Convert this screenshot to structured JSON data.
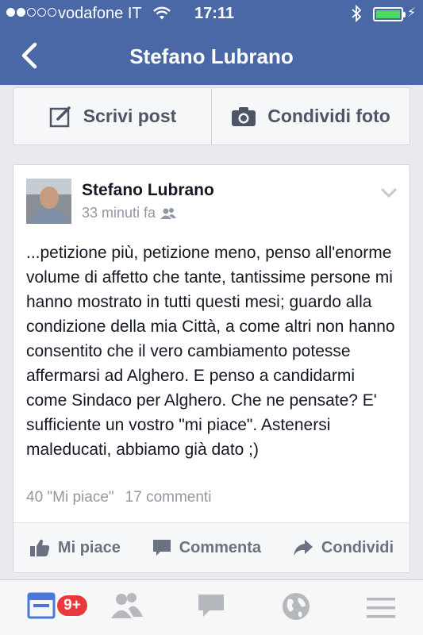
{
  "status_bar": {
    "carrier": "vodafone IT",
    "time": "17:11",
    "signal_bars_filled": 2,
    "signal_bars_total": 5
  },
  "nav": {
    "title": "Stefano Lubrano",
    "back_icon": "chevron-left-icon"
  },
  "actions": {
    "write_post_label": "Scrivi post",
    "share_photo_label": "Condividi foto"
  },
  "post": {
    "author": "Stefano Lubrano",
    "time": "33 minuti fa",
    "audience_icon": "friends-icon",
    "text": "...petizione più, petizione meno, penso all'enorme volume di affetto che tante, tantissime persone mi hanno mostrato in tutti questi mesi; guardo alla condizione della mia Città, a come altri non hanno consentito che il vero cambiamento potesse affermarsi ad Alghero. E penso a candidarmi come Sindaco per Alghero. Che ne pensate? E' sufficiente un vostro \"mi piace\". Astenersi maleducati, abbiamo già dato ;)",
    "likes": "40 \"Mi piace\"",
    "comments": "17 commenti",
    "like_label": "Mi piace",
    "comment_label": "Commenta",
    "share_label": "Condividi"
  },
  "tabbar": {
    "badge": "9+"
  },
  "colors": {
    "brand_blue": "#4a67a6",
    "badge_red": "#e8393b",
    "battery_green": "#4cd964"
  }
}
